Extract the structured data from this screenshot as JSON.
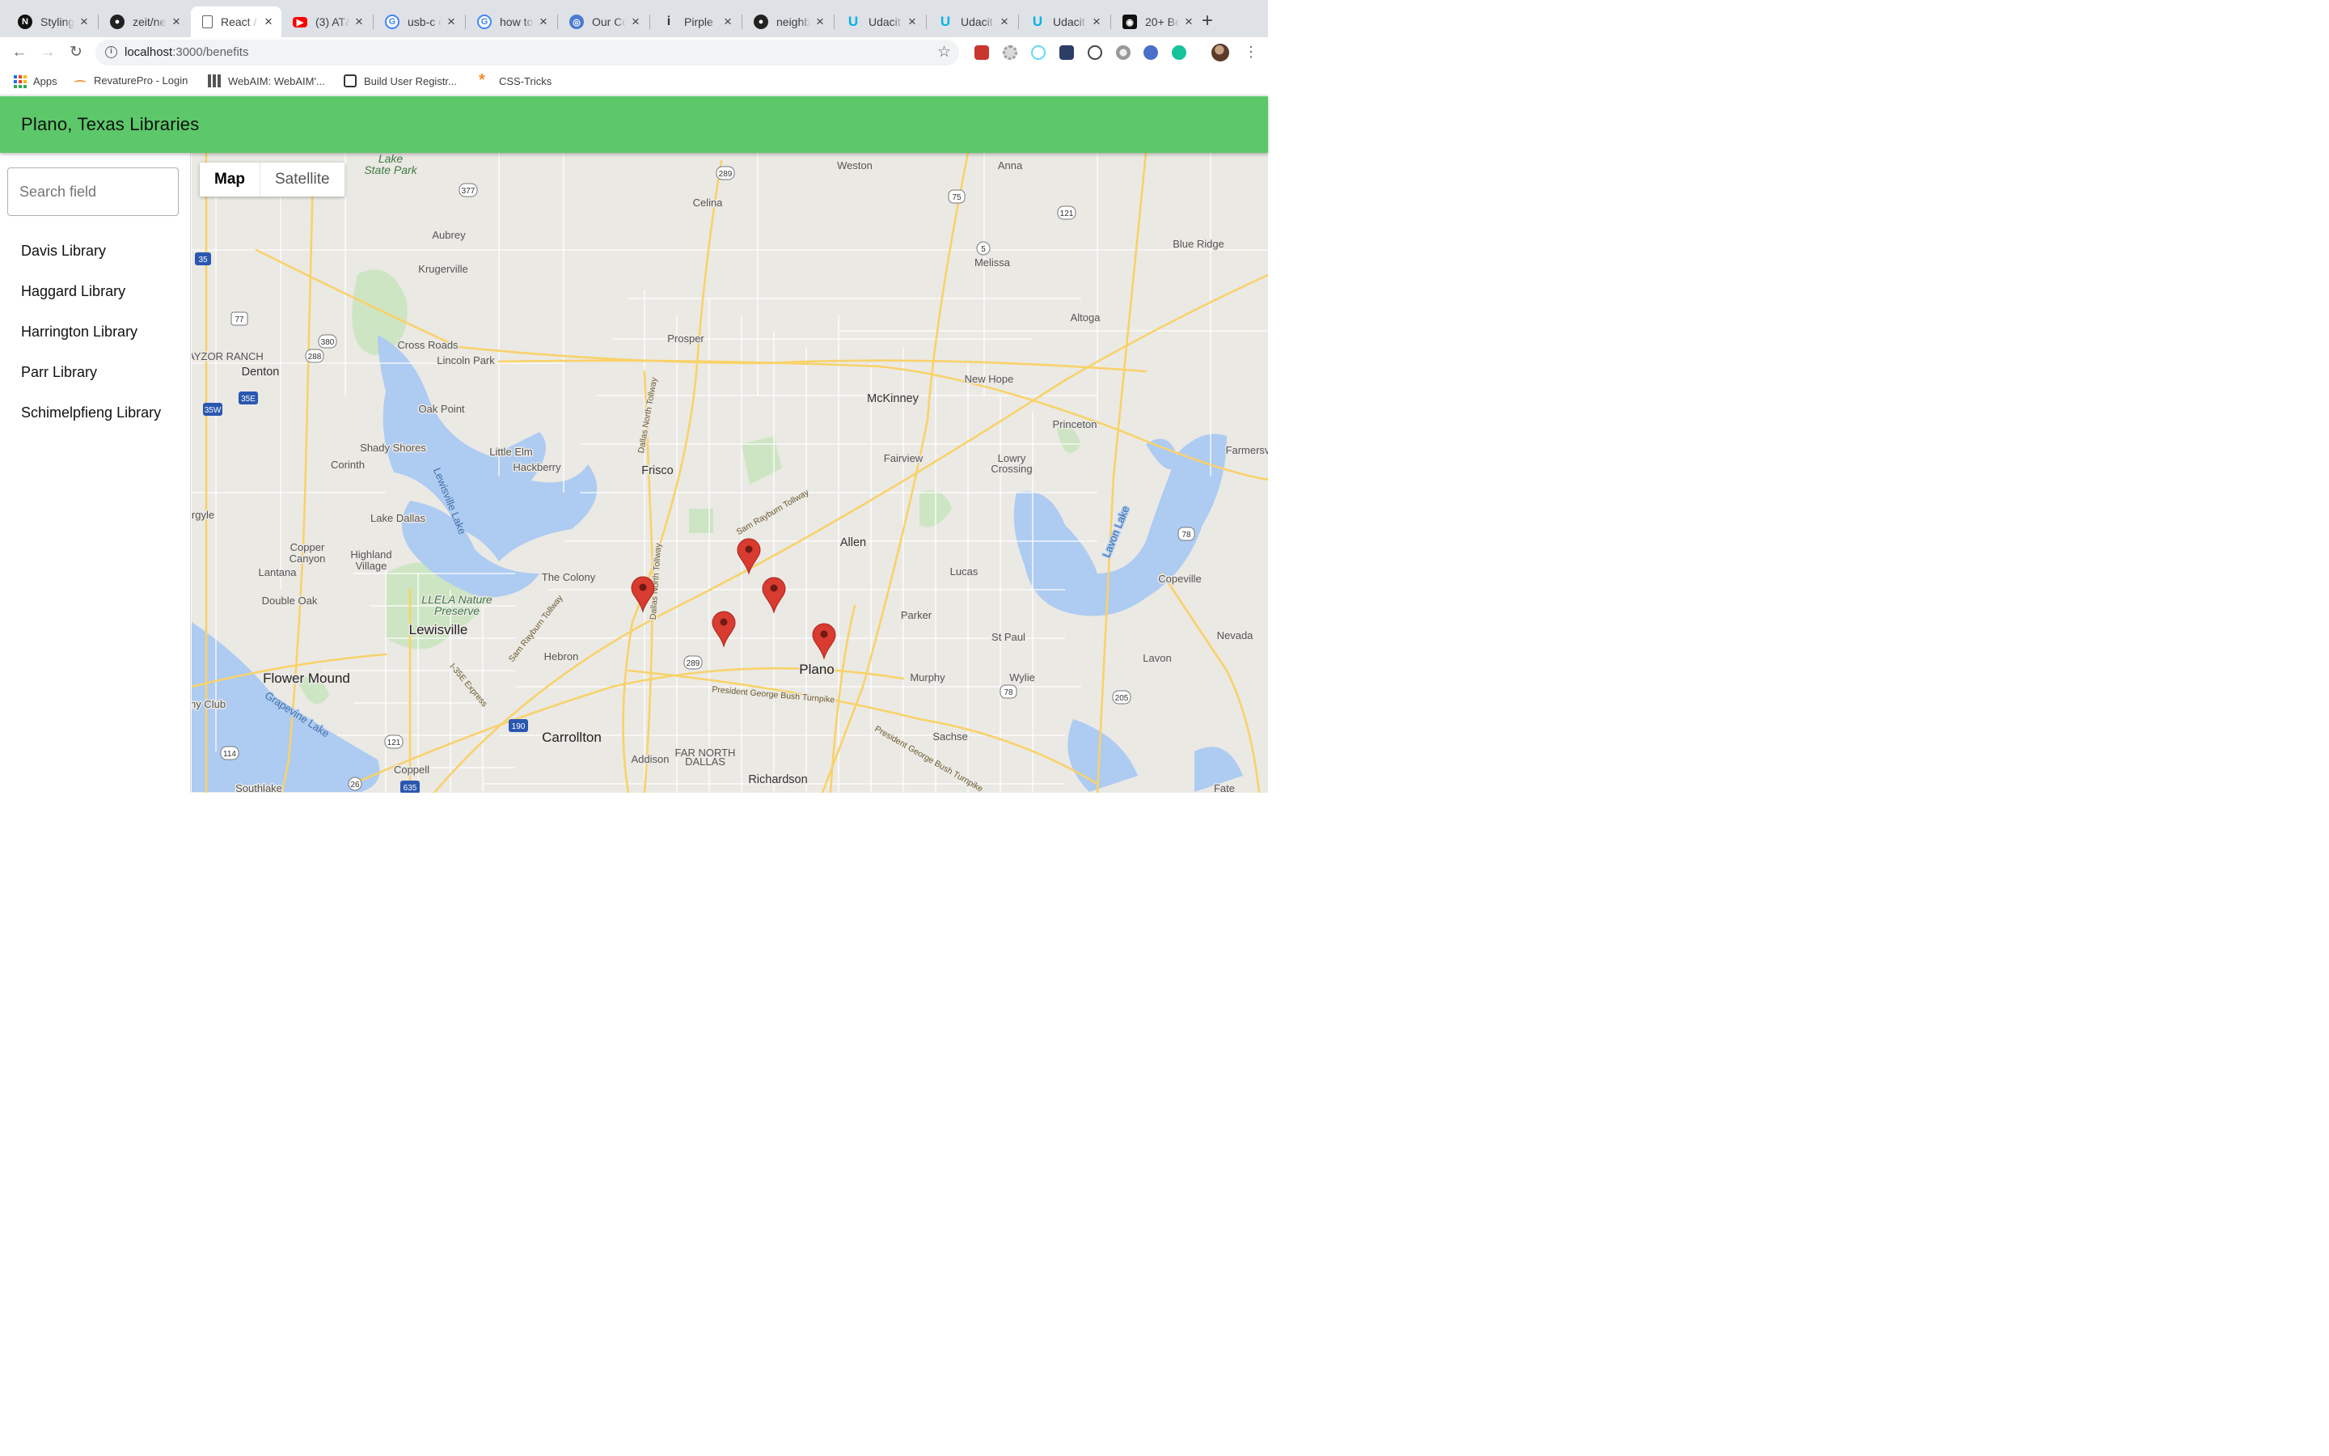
{
  "browser": {
    "tabs": [
      {
        "title": "Styling",
        "active": false
      },
      {
        "title": "zeit/ne",
        "active": false
      },
      {
        "title": "React /",
        "active": true
      },
      {
        "title": "(3) AT&",
        "active": false
      },
      {
        "title": "usb-c c",
        "active": false
      },
      {
        "title": "how to",
        "active": false
      },
      {
        "title": "Our Co",
        "active": false
      },
      {
        "title": "Pirple",
        "active": false
      },
      {
        "title": "neighb",
        "active": false
      },
      {
        "title": "Udacit",
        "active": false
      },
      {
        "title": "Udacit",
        "active": false
      },
      {
        "title": "Udacit",
        "active": false
      },
      {
        "title": "20+ Be",
        "active": false
      }
    ],
    "url_host": "localhost",
    "url_path": ":3000/benefits",
    "bookmarks": [
      "Apps",
      "RevaturePro - Login",
      "WebAIM: WebAIM'...",
      "Build User Registr...",
      "CSS-Tricks"
    ]
  },
  "app": {
    "title": "Plano, Texas Libraries",
    "search_placeholder": "Search field",
    "libraries": [
      "Davis Library",
      "Haggard Library",
      "Harrington Library",
      "Parr Library",
      "Schimelpfieng Library"
    ]
  },
  "map": {
    "type_buttons": {
      "map": "Map",
      "satellite": "Satellite"
    },
    "marker_color": "#d93b30",
    "labels": {
      "lake_state_park": [
        "Lake",
        "State Park"
      ],
      "weston": "Weston",
      "anna": "Anna",
      "celina": "Celina",
      "aubrey": "Aubrey",
      "krugerville": "Krugerville",
      "melissa": "Melissa",
      "blue_ridge": "Blue Ridge",
      "altoga": "Altoga",
      "prosper": "Prosper",
      "cross_roads": "Cross Roads",
      "lincoln_park": "Lincoln Park",
      "denton": "Denton",
      "ranch": "AYZOR RANCH",
      "mckinney": "McKinney",
      "new_hope": "New Hope",
      "princeton": "Princeton",
      "farmersville": "Farmersv",
      "oak_point": "Oak Point",
      "shady_shores": "Shady Shores",
      "little_elm": "Little Elm",
      "hackberry": "Hackberry",
      "frisco": "Frisco",
      "corinth": "Corinth",
      "fairview": "Fairview",
      "lowry_crossing": [
        "Lowry",
        "Crossing"
      ],
      "argyle": "rgyle",
      "lake_dallas": "Lake Dallas",
      "allen": "Allen",
      "copper_canyon": [
        "Copper",
        "Canyon"
      ],
      "highland_village": [
        "Highland",
        "Village"
      ],
      "lantana": "Lantana",
      "the_colony": "The Colony",
      "lucas": "Lucas",
      "copeville": "Copeville",
      "double_oak": "Double Oak",
      "llela": [
        "LLELA Nature",
        "Preserve"
      ],
      "lewisville": "Lewisville",
      "parker": "Parker",
      "st_paul": "St Paul",
      "nevada": "Nevada",
      "hebron": "Hebron",
      "plano": "Plano",
      "lavon": "Lavon",
      "flower_mound": "Flower Mound",
      "murphy": "Murphy",
      "wylie": "Wylie",
      "country_club": "ny Club",
      "carrollton": "Carrollton",
      "sachse": "Sachse",
      "addison": "Addison",
      "far_north_dallas": [
        "FAR NORTH",
        "DALLAS"
      ],
      "coppell": "Coppell",
      "richardson": "Richardson",
      "southlake": "Southlake",
      "fate": "Fate",
      "lewisville_lake": "Lewisville Lake",
      "grapevine_lake": "Grapevine Lake",
      "lavon_lake": "Lavon Lake",
      "dnt": "Dallas North Tollway",
      "srt": "Sam Rayburn Tollway",
      "pgbt": "President George Bush Turnpike",
      "i35e_express": "I-35E Express"
    },
    "shields": [
      "289",
      "377",
      "75",
      "121",
      "5",
      "35",
      "77",
      "380",
      "288",
      "35E",
      "35W",
      "78",
      "205",
      "190",
      "635",
      "114",
      "26",
      "289",
      "121",
      "78"
    ]
  }
}
